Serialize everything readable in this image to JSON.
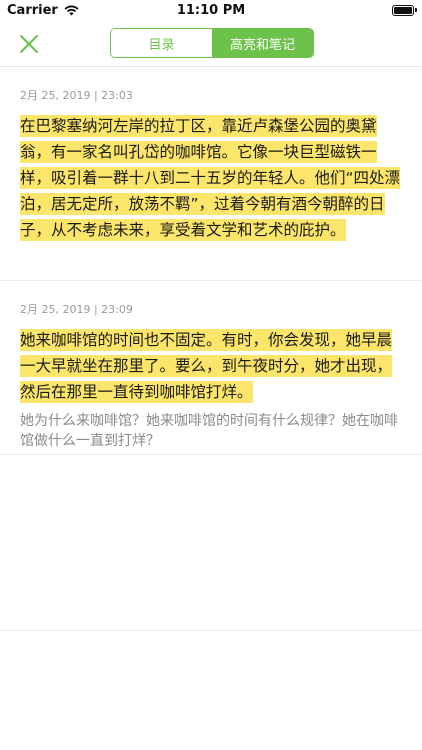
{
  "status_bar": {
    "carrier": "Carrier",
    "time": "11:10 PM",
    "battery_level": 0.9
  },
  "nav": {
    "close_icon": "close-icon",
    "tabs": [
      {
        "label": "目录",
        "active": false
      },
      {
        "label": "高亮和笔记",
        "active": true
      }
    ]
  },
  "notes": [
    {
      "date": "2月 25, 2019 | 23:03",
      "quote": "在巴黎塞纳河左岸的拉丁区，靠近卢森堡公园的奥黛翁，有一家名叫孔岱的咖啡馆。它像一块巨型磁铁一样，吸引着一群十八到二十五岁的年轻人。他们“四处漂泊，居无定所，放荡不羁”，过着今朝有酒今朝醉的日子，从不考虑未来，享受着文学和艺术的庇护。",
      "comment": ""
    },
    {
      "date": "2月 25, 2019 | 23:09",
      "quote": "她来咖啡馆的时间也不固定。有时，你会发现，她早晨一大早就坐在那里了。要么，到午夜时分，她才出现，然后在那里一直待到咖啡馆打烊。",
      "comment": "她为什么来咖啡馆？她来咖啡馆的时间有什么规律？她在咖啡馆做什么一直到打烊？"
    }
  ],
  "colors": {
    "accent": "#6cc24a",
    "highlight": "#fbe56b",
    "date_text": "#9a9a9a",
    "comment_text": "#8a8a8a"
  }
}
